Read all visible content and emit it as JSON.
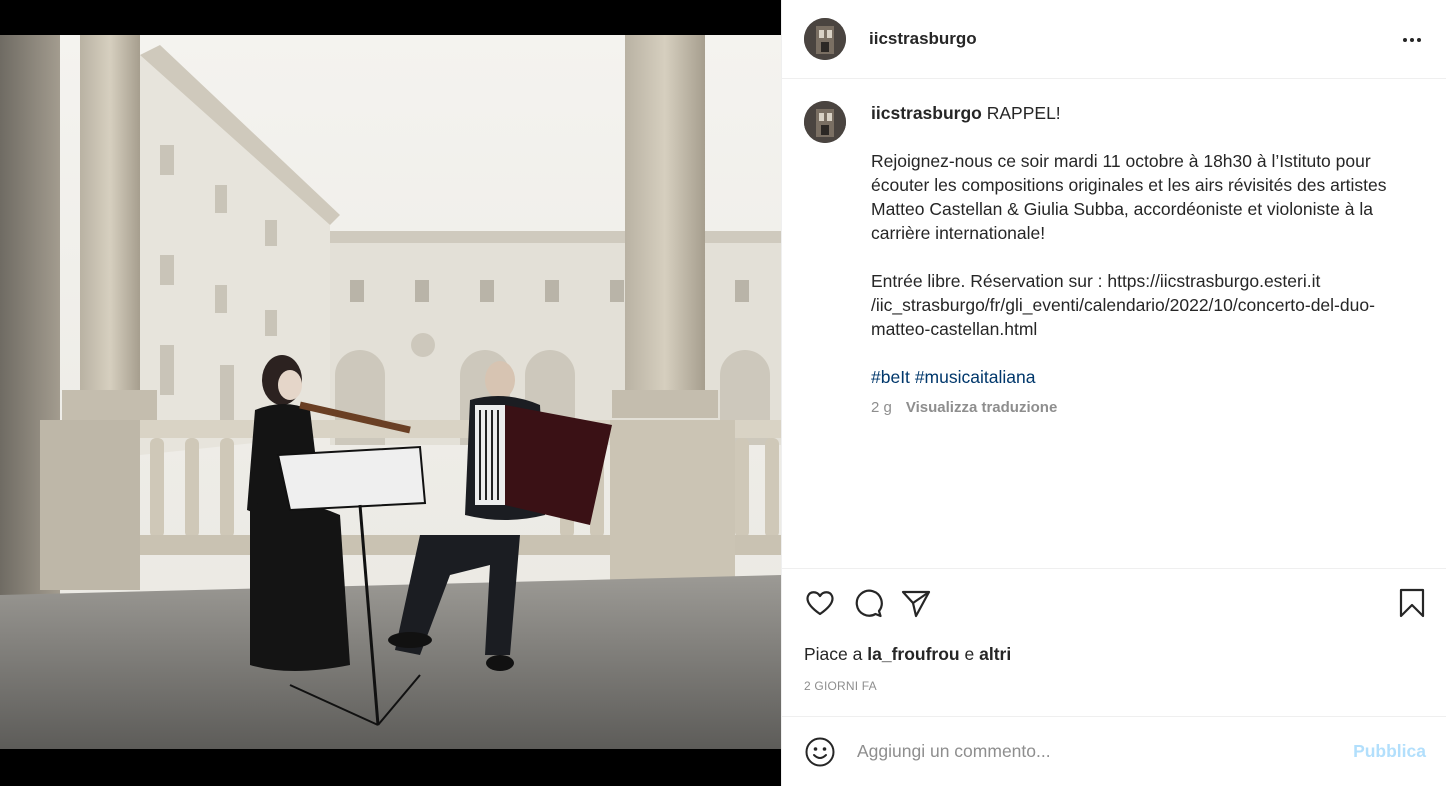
{
  "post": {
    "username": "iicstrasburgo",
    "more_icon": "more-horizontal-icon",
    "image_icon": "concert-photo"
  },
  "caption": {
    "username": "iicstrasburgo",
    "headline": "RAPPEL!",
    "paragraph1": "Rejoignez-nous ce soir mardi 11 octobre à 18h30 à l’Istituto pour écouter les compositions originales et les airs révisités des artistes Matteo Castellan & Giulia Subba, accordéoniste et violoniste à la carrière internationale!",
    "paragraph2": "Entrée libre. Réservation sur : https://iicstrasburgo.esteri.it /iic_strasburgo/fr/gli_eventi/calendario/2022/10/concerto-del-duo-matteo-castellan.html",
    "hashtags": [
      "#beIt",
      "#musicaitaliana"
    ],
    "age": "2 g",
    "translate_label": "Visualizza traduzione"
  },
  "actions": {
    "like_icon": "heart-icon",
    "comment_icon": "comment-icon",
    "share_icon": "paper-plane-icon",
    "save_icon": "bookmark-icon"
  },
  "likes": {
    "prefix": "Piace a",
    "user": "la_froufrou",
    "joiner": "e",
    "others": "altri"
  },
  "timestamp": "2 GIORNI FA",
  "comment": {
    "emoji_icon": "emoji-icon",
    "placeholder": "Aggiungi un commento...",
    "publish_label": "Pubblica"
  },
  "colors": {
    "link": "#00376b",
    "muted": "#8e8e8e",
    "publish_disabled": "#b2dffc",
    "text": "#262626"
  }
}
